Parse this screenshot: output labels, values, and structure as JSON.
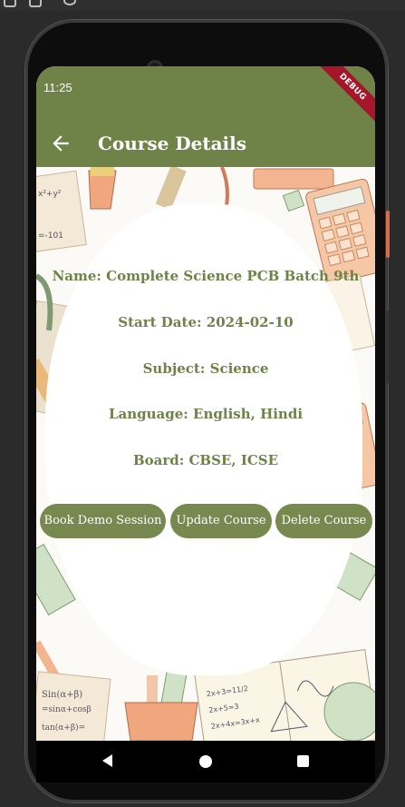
{
  "status_bar": {
    "time": "11:25"
  },
  "debug_banner": "DEBUG",
  "app_bar": {
    "title": "Course Details",
    "back_icon": "arrow-back-icon"
  },
  "course": {
    "name": "Name: Complete Science PCB Batch 9th",
    "start_date": "Start Date: 2024-02-10",
    "subject": "Subject: Science",
    "language": "Language: English, Hindi",
    "board": "Board: CBSE, ICSE"
  },
  "actions": {
    "book_demo": "Book Demo Session",
    "update": "Update Course",
    "delete": "Delete Course"
  },
  "nav_bar": {
    "back_icon": "nav-back-icon",
    "home_icon": "nav-home-icon",
    "recents_icon": "nav-recents-icon"
  },
  "colors": {
    "app_bar": "#6f8348",
    "button": "#77894f",
    "text_accent": "#6f8348",
    "debug": "#a5162a"
  }
}
